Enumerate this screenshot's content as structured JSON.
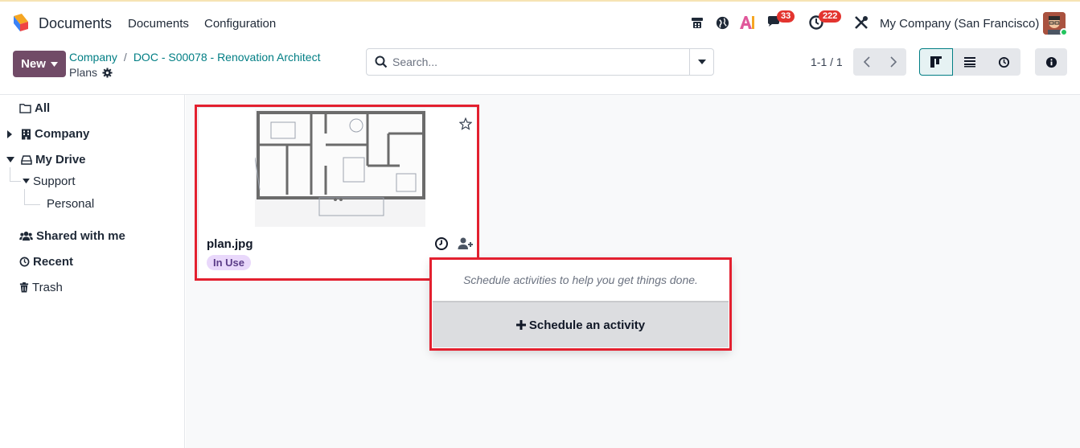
{
  "topbar": {
    "app_name": "Documents",
    "menus": [
      "Documents",
      "Configuration"
    ],
    "messages_badge": "33",
    "activities_badge": "222",
    "company": "My Company (San Francisco)"
  },
  "control": {
    "new_label": "New",
    "breadcrumb": [
      "Company",
      "DOC - S00078 - Renovation Architect"
    ],
    "current": "Plans",
    "search_placeholder": "Search...",
    "pager": "1-1 / 1"
  },
  "sidebar": {
    "folders": [
      {
        "label": "All"
      },
      {
        "label": "Company"
      },
      {
        "label": "My Drive"
      },
      {
        "label": "Support"
      },
      {
        "label": "Personal"
      },
      {
        "label": "Shared with me"
      },
      {
        "label": "Recent"
      },
      {
        "label": "Trash"
      }
    ]
  },
  "card": {
    "name": "plan.jpg",
    "tag": "In Use"
  },
  "popover": {
    "hint": "Schedule activities to help you get things done.",
    "button_label": "Schedule an activity"
  },
  "colors": {
    "brand": "#714b67",
    "link": "#017e84",
    "highlight": "#e3202f",
    "badge": "#e3342f"
  }
}
